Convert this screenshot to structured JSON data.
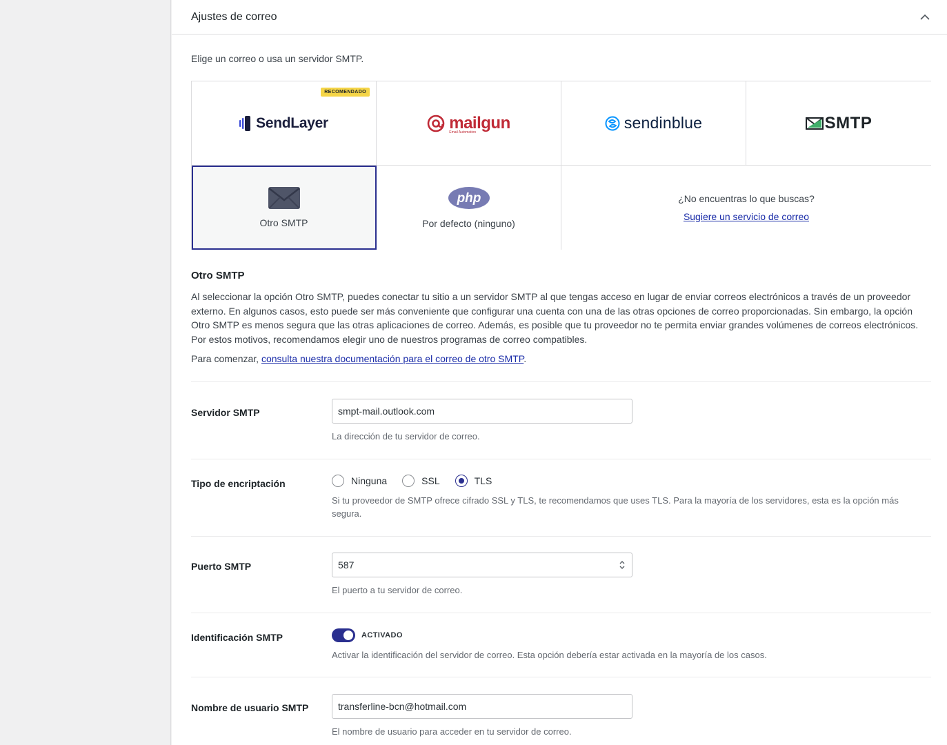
{
  "panel": {
    "title": "Ajustes de correo",
    "intro": "Elige un correo o usa un servidor SMTP."
  },
  "mailers": {
    "sendlayer": {
      "name": "SendLayer",
      "badge": "RECOMENDADO"
    },
    "mailgun": {
      "name": "mailgun",
      "sub": "Email Automation"
    },
    "sendinblue": {
      "name": "sendinblue"
    },
    "smtp": {
      "name": "SMTP"
    },
    "other_smtp": {
      "label": "Otro SMTP"
    },
    "php": {
      "label": "Por defecto (ninguno)",
      "logo_text": "php"
    },
    "suggest": {
      "question": "¿No encuentras lo que buscas?",
      "link": "Sugiere un servicio de correo"
    }
  },
  "section": {
    "title": "Otro SMTP",
    "description": "Al seleccionar la opción Otro SMTP, puedes conectar tu sitio a un servidor SMTP al que tengas acceso en lugar de enviar correos electrónicos a través de un proveedor externo. En algunos casos, esto puede ser más conveniente que configurar una cuenta con una de las otras opciones de correo proporcionadas. Sin embargo, la opción Otro SMTP es menos segura que las otras aplicaciones de correo. Además, es posible que tu proveedor no te permita enviar grandes volúmenes de correos electrónicos. Por estos motivos, recomendamos elegir uno de nuestros programas de correo compatibles.",
    "get_started_prefix": "Para comenzar, ",
    "get_started_link": "consulta nuestra documentación para el correo de otro SMTP",
    "get_started_suffix": "."
  },
  "fields": {
    "smtp_host": {
      "label": "Servidor SMTP",
      "value": "smpt-mail.outlook.com",
      "help": "La dirección de tu servidor de correo."
    },
    "encryption": {
      "label": "Tipo de encriptación",
      "options": [
        "Ninguna",
        "SSL",
        "TLS"
      ],
      "selected": "TLS",
      "help": "Si tu proveedor de SMTP ofrece cifrado SSL y TLS, te recomendamos que uses TLS. Para la mayoría de los servidores, esta es la opción más segura."
    },
    "port": {
      "label": "Puerto SMTP",
      "value": "587",
      "help": "El puerto a tu servidor de correo."
    },
    "auth": {
      "label": "Identificación SMTP",
      "state": "ACTIVADO",
      "help": "Activar la identificación del servidor de correo. Esta opción debería estar activada en la mayoría de los casos."
    },
    "username": {
      "label": "Nombre de usuario SMTP",
      "value": "transferline-bcn@hotmail.com",
      "help": "El nombre de usuario para acceder en tu servidor de correo."
    }
  },
  "colors": {
    "accent": "#2a2f8f",
    "link": "#1a2ca8",
    "badge": "#f5d547",
    "mailgun": "#c02b37",
    "sendinblue": "#0092ff"
  }
}
